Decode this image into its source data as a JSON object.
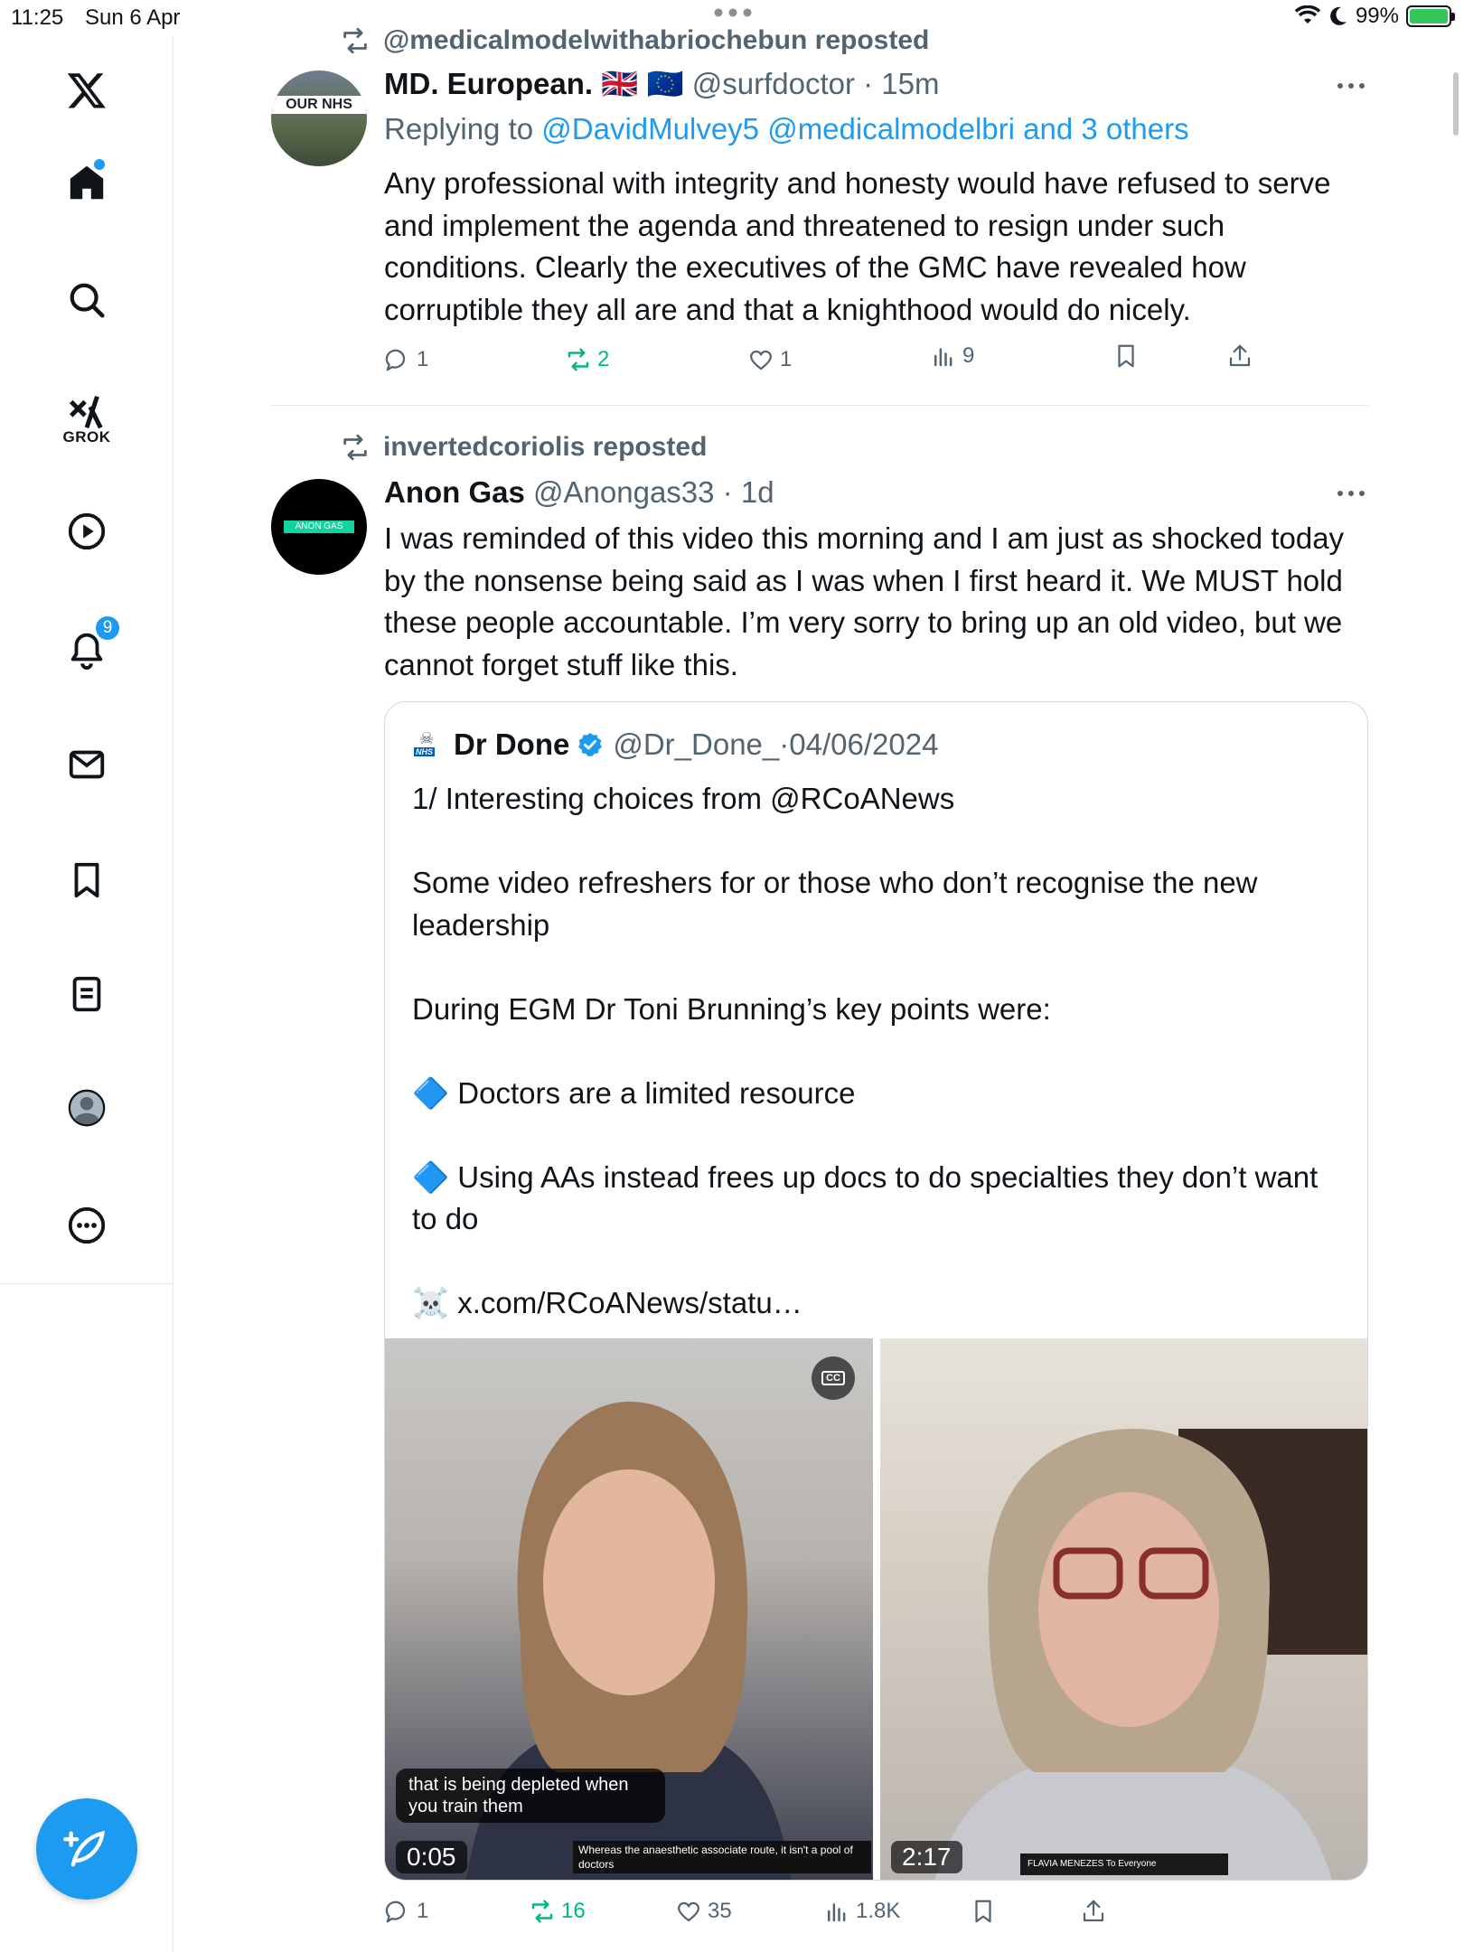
{
  "status_bar": {
    "time": "11:25",
    "date": "Sun 6 Apr",
    "battery": "99%"
  },
  "sidebar": {
    "grok_label": "GROK",
    "notifications_count": "9",
    "accent_color": "#1d9bf0",
    "icons": [
      "x-logo-icon",
      "home-icon",
      "search-icon",
      "grok-icon",
      "video-icon",
      "bell-icon",
      "mail-icon",
      "bookmark-icon",
      "lists-icon",
      "profile-icon",
      "more-icon",
      "compose-icon"
    ]
  },
  "posts": [
    {
      "reposted_by": "@medicalmodelwithabriochebun reposted",
      "name": "MD. European.",
      "flags": "🇬🇧 🇪🇺",
      "handle": "@surfdoctor",
      "time": "15m",
      "reply_prefix": "Replying to",
      "reply_links": "@DavidMulvey5 @medicalmodelbri and 3 others",
      "body": "Any professional with integrity and honesty would have refused to serve and implement the agenda and threatened to resign under such conditions. Clearly the executives of the GMC have revealed how corruptible they all are and that a knighthood would do nicely.",
      "avatar_text": "OUR NHS",
      "replies": "1",
      "reposts": "2",
      "likes": "1",
      "views": "9"
    },
    {
      "reposted_by": "invertedcoriolis reposted",
      "name": "Anon Gas",
      "handle": "@Anongas33",
      "time": "1d",
      "avatar_text": "ANON GAS",
      "body": "I was reminded of this video this morning and I am just as shocked today by the nonsense being said as I was when I first heard it. We MUST hold these people accountable. I’m very sorry to bring up an old video, but we cannot forget stuff like this.",
      "replies": "1",
      "reposts": "16",
      "likes": "35",
      "views": "1.8K"
    }
  ],
  "quote": {
    "avatar_text": "NHS",
    "name": "Dr Done",
    "handle": "@Dr_Done_",
    "date": "04/06/2024",
    "text": "1/ Interesting choices from @RCoANews\n\nSome video refreshers for or those who don’t recognise the new leadership\n\nDuring EGM Dr Toni Brunning’s key points were:\n\n🔷 Doctors are a limited resource\n\n🔷 Using AAs instead frees up docs to do specialties they don’t want to do\n\n☠️ x.com/RCoANews/statu…",
    "video1": {
      "duration": "0:05",
      "caption": "that is being depleted when you train them",
      "subtitle": "Whereas the anaesthetic associate route, it isn't a pool of doctors",
      "cc": "CC"
    },
    "video2": {
      "duration": "2:17",
      "name_bar": "FLAVIA MENEZES To Everyone"
    }
  }
}
